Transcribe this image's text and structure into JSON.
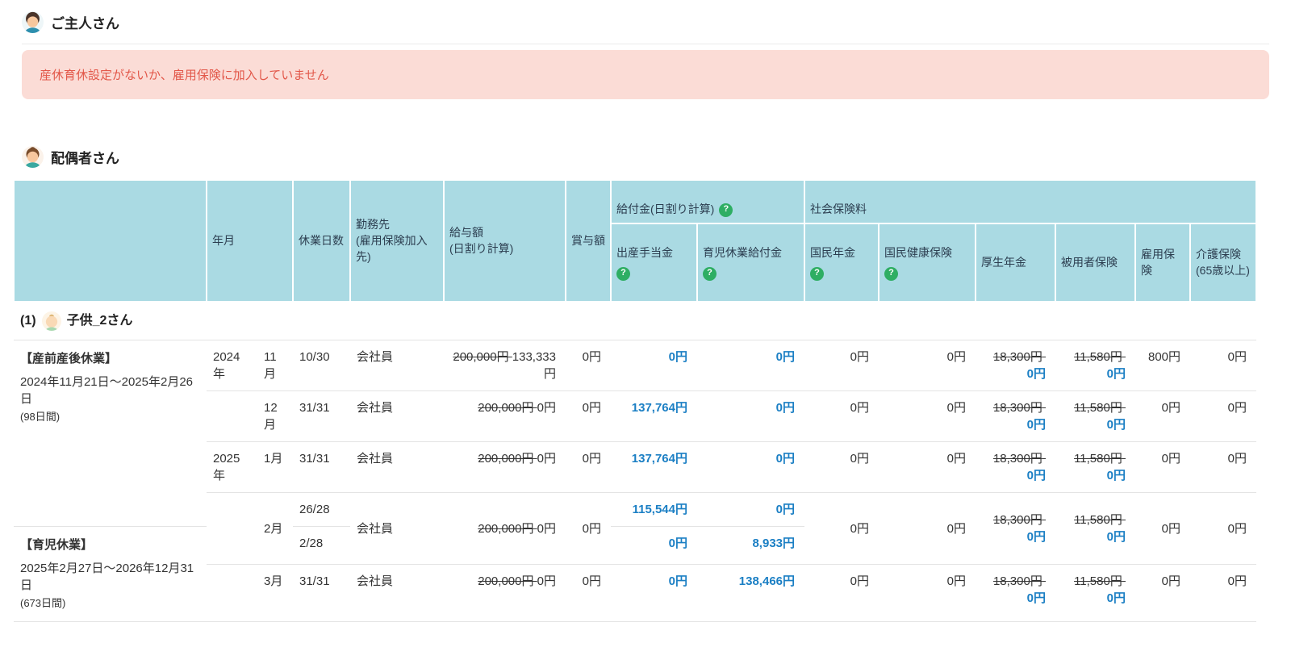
{
  "icons": {
    "help": "?"
  },
  "colors": {
    "header_bg": "#aadae3",
    "accent_blue": "#1b7fc4",
    "alert_bg": "#fbdcd6",
    "alert_text": "#e25749",
    "badge_green": "#2eae63"
  },
  "husband": {
    "title": "ご主人さん"
  },
  "alert": {
    "message": "産休育休設定がないか、雇用保険に加入していません"
  },
  "spouse": {
    "title": "配偶者さん"
  },
  "child": {
    "index": "(1)",
    "name": "子供_2さん"
  },
  "table": {
    "headers": {
      "year_month": "年月",
      "leave_days": "休業日数",
      "workplace": "勤務先\n(雇用保険加入先)",
      "salary": "給与額\n(日割り計算)",
      "bonus": "賞与額",
      "benefits_group": "給付金(日割り計算)",
      "maternity_allowance": "出産手当金",
      "childcare_benefit": "育児休業給付金",
      "social_insurance_group": "社会保険料",
      "national_pension": "国民年金",
      "national_health_insurance": "国民健康保険",
      "employees_pension": "厚生年金",
      "employees_insurance": "被用者保険",
      "employment_insurance": "雇用保険",
      "care_insurance": "介護保険(65歳以上)"
    },
    "rows": [
      {
        "label_title": "【産前産後休業】",
        "label_range": "2024年11月21日〜2025年2月26日",
        "label_days": "(98日間)",
        "year": "2024年",
        "month": "11月",
        "leave_days": "10/30",
        "workplace": "会社員",
        "salary_old": "200,000円",
        "salary_new": "133,333円",
        "bonus": "0円",
        "maternity_allowance": "0円",
        "childcare_benefit": "0円",
        "national_pension": "0円",
        "national_health_insurance": "0円",
        "employees_pension_old": "18,300円",
        "employees_pension_new": "0円",
        "employees_insurance_old": "11,580円",
        "employees_insurance_new": "0円",
        "employment_insurance": "800円",
        "care_insurance": "0円"
      },
      {
        "year": "",
        "month": "12月",
        "leave_days": "31/31",
        "workplace": "会社員",
        "salary_old": "200,000円",
        "salary_new": "0円",
        "bonus": "0円",
        "maternity_allowance": "137,764円",
        "childcare_benefit": "0円",
        "national_pension": "0円",
        "national_health_insurance": "0円",
        "employees_pension_old": "18,300円",
        "employees_pension_new": "0円",
        "employees_insurance_old": "11,580円",
        "employees_insurance_new": "0円",
        "employment_insurance": "0円",
        "care_insurance": "0円"
      },
      {
        "year": "2025年",
        "month": "1月",
        "leave_days": "31/31",
        "workplace": "会社員",
        "salary_old": "200,000円",
        "salary_new": "0円",
        "bonus": "0円",
        "maternity_allowance": "137,764円",
        "childcare_benefit": "0円",
        "national_pension": "0円",
        "national_health_insurance": "0円",
        "employees_pension_old": "18,300円",
        "employees_pension_new": "0円",
        "employees_insurance_old": "11,580円",
        "employees_insurance_new": "0円",
        "employment_insurance": "0円",
        "care_insurance": "0円"
      },
      {
        "year": "",
        "month": "2月",
        "leave_days": "26/28",
        "workplace": "会社員",
        "salary_old": "200,000円",
        "salary_new": "0円",
        "bonus": "0円",
        "maternity_allowance": "115,544円",
        "childcare_benefit": "0円",
        "national_pension": "0円",
        "national_health_insurance": "0円",
        "employees_pension_old": "18,300円",
        "employees_pension_new": "0円",
        "employees_insurance_old": "11,580円",
        "employees_insurance_new": "0円",
        "employment_insurance": "0円",
        "care_insurance": "0円"
      },
      {
        "label_title": "【育児休業】",
        "label_range": "2025年2月27日〜2026年12月31日",
        "label_days": "(673日間)",
        "leave_days": "2/28",
        "maternity_allowance": "0円",
        "childcare_benefit": "8,933円"
      },
      {
        "year": "",
        "month": "3月",
        "leave_days": "31/31",
        "workplace": "会社員",
        "salary_old": "200,000円",
        "salary_new": "0円",
        "bonus": "0円",
        "maternity_allowance": "0円",
        "childcare_benefit": "138,466円",
        "national_pension": "0円",
        "national_health_insurance": "0円",
        "employees_pension_old": "18,300円",
        "employees_pension_new": "0円",
        "employees_insurance_old": "11,580円",
        "employees_insurance_new": "0円",
        "employment_insurance": "0円",
        "care_insurance": "0円"
      }
    ]
  }
}
